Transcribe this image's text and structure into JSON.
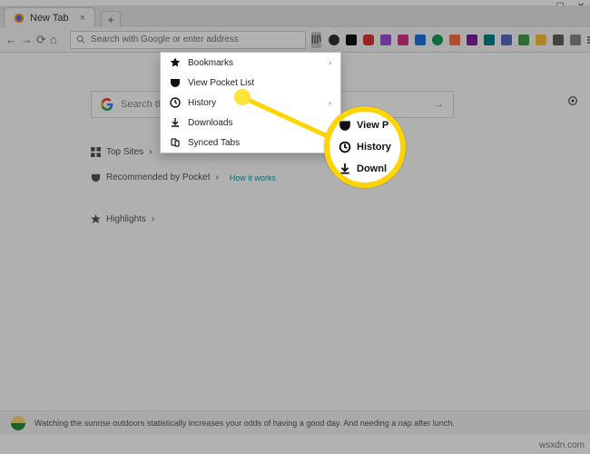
{
  "window": {
    "tab_title": "New Tab",
    "tab_close": "×",
    "new_tab_plus": "+",
    "min": "—",
    "max": "☐",
    "close": "✕"
  },
  "toolbar": {
    "back": "←",
    "forward": "→",
    "reload": "⟳",
    "home": "⌂",
    "library": "|||\\",
    "address_placeholder": "Search with Google or enter address"
  },
  "menu": {
    "bookmarks": "Bookmarks",
    "pocket": "View Pocket List",
    "history": "History",
    "downloads": "Downloads",
    "synced": "Synced Tabs"
  },
  "content": {
    "search_placeholder": "Search the Web",
    "arrow": "→",
    "customize_icon": "⚙",
    "top_sites": "Top Sites",
    "recommended": "Recommended by Pocket",
    "how_it_works": "How it works",
    "highlights": "Highlights",
    "chevron": "›"
  },
  "zoom": {
    "row1": "View P",
    "row2": "History",
    "row3": "Downl"
  },
  "snippet": {
    "text": "Watching the sunrise outdoors statistically increases your odds of having a good day. And needing a nap after lunch."
  },
  "watermark": "wsxdn.com",
  "colors": {
    "accent": "#ffd400"
  }
}
